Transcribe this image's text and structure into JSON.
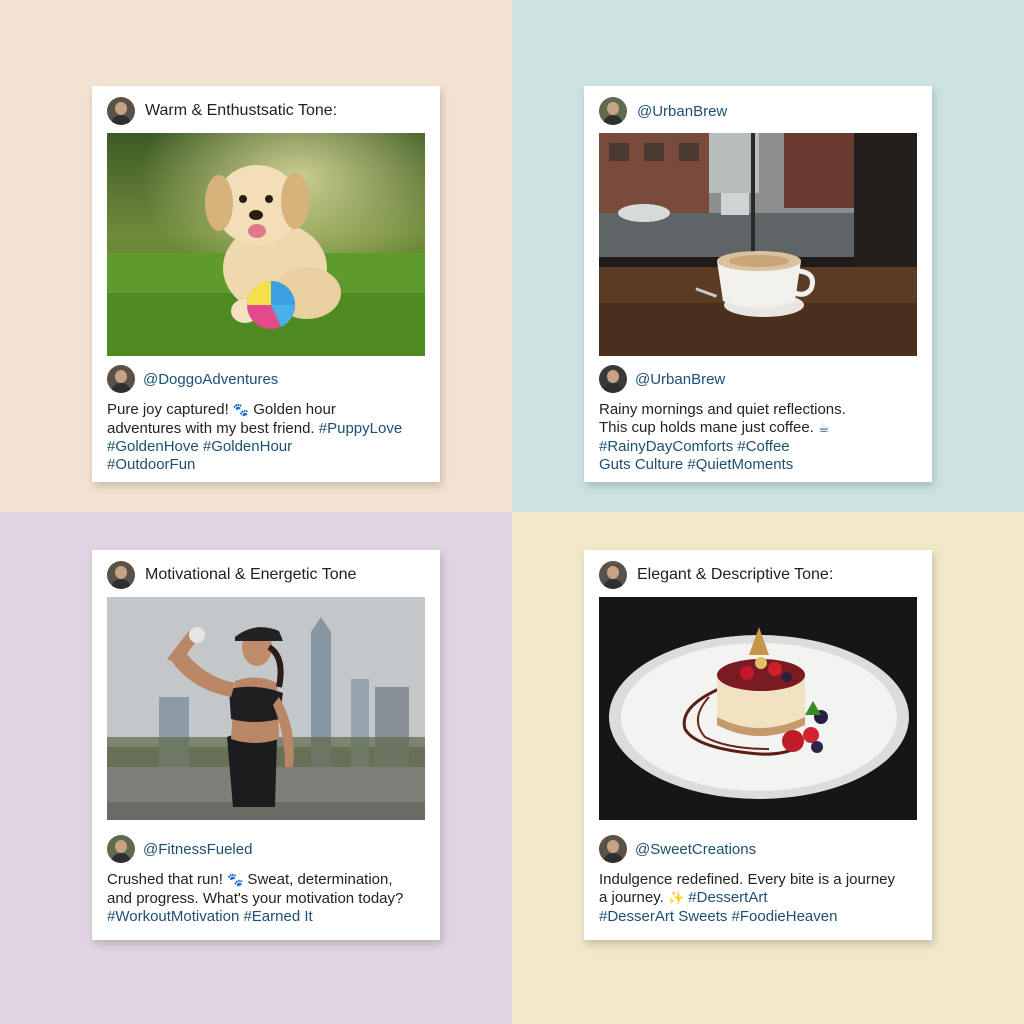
{
  "panels": [
    {
      "header_title": "Warm & Enthustsatic Tone:",
      "username": "@DoggoAdventures",
      "caption_lines": [
        {
          "text": "Pure joy captured! ",
          "emoji": "🐾",
          "after": " Golden hour",
          "tags": ""
        },
        {
          "text": "adventures with my best friend. ",
          "emoji": "",
          "after": "",
          "tags": "#PuppyLove"
        },
        {
          "text": "",
          "emoji": "",
          "after": "",
          "tags": "#GoldenHove #GoldenHour"
        },
        {
          "text": "",
          "emoji": "",
          "after": "",
          "tags": "#OutdoorFun"
        }
      ],
      "photo": "golden-retriever-puppy-with-ball"
    },
    {
      "header_title": "@UrbanBrew",
      "username": "@UrbanBrew",
      "caption_lines": [
        {
          "text": "Rainy mornings and quiet reflections.",
          "emoji": "",
          "after": "",
          "tags": ""
        },
        {
          "text": "This cup holds mane just coffee. ",
          "emoji": "☕",
          "after": "",
          "tags": ""
        },
        {
          "text": "",
          "emoji": "",
          "after": "",
          "tags": "#RainyDayComforts #Coffee"
        },
        {
          "text": "",
          "emoji": "",
          "after": "",
          "tags": "Guts Culture #QuietMoments"
        }
      ],
      "photo": "coffee-cup-by-rainy-window"
    },
    {
      "header_title": "Motivational & Energetic Tone",
      "username": "@FitnessFueled",
      "caption_lines": [
        {
          "text": "Crushed that run! ",
          "emoji": "🐾",
          "after": " Sweat, determination,",
          "tags": ""
        },
        {
          "text": "and progress. What's your motivation today?",
          "emoji": "",
          "after": "",
          "tags": ""
        },
        {
          "text": "",
          "emoji": "",
          "after": "",
          "tags": "#WorkoutMotivation #Earned It"
        }
      ],
      "photo": "woman-flexing-city-skyline"
    },
    {
      "header_title": "Elegant & Descriptive Tone:",
      "username": "@SweetCreations",
      "caption_lines": [
        {
          "text": "Indulgence redefined. Every bite is a journey",
          "emoji": "",
          "after": "",
          "tags": ""
        },
        {
          "text": "a journey. ",
          "emoji": "✨",
          "after": " ",
          "tags": "#DessertArt"
        },
        {
          "text": "",
          "emoji": "",
          "after": "",
          "tags": "#DesserArt Sweets #FoodieHeaven"
        }
      ],
      "photo": "plated-cheesecake-with-berries"
    }
  ],
  "colors": {
    "tag_blue": "#1d4f73",
    "paw_blue": "#1d4f73",
    "paw_gold": "#e0a020",
    "sparkle_gold": "#f0b020"
  }
}
